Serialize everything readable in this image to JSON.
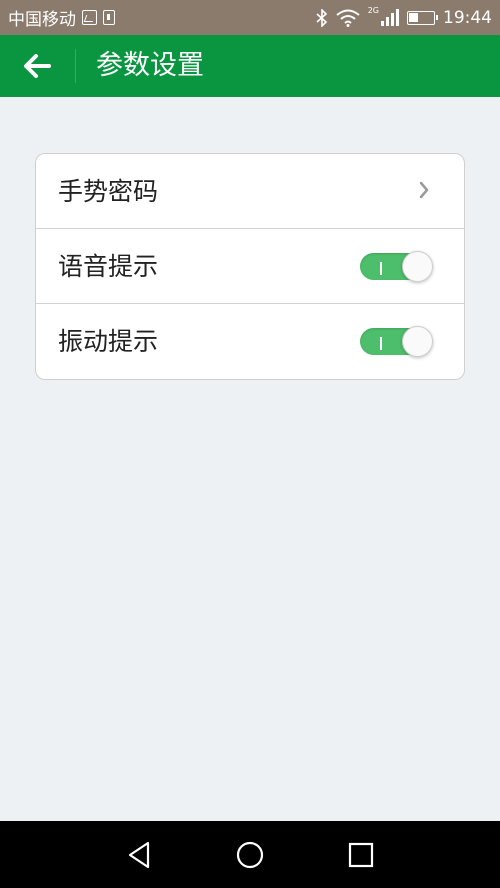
{
  "status_bar": {
    "carrier": "中国移动",
    "network_label": "2G",
    "time": "19:44",
    "icons": [
      "image-icon",
      "sd-card-icon",
      "bluetooth-icon",
      "wifi-icon",
      "signal-icon",
      "battery-icon"
    ]
  },
  "app_bar": {
    "title": "参数设置",
    "back_icon": "arrow-left-icon",
    "background_color": "#0a9640"
  },
  "settings": {
    "items": [
      {
        "label": "手势密码",
        "control": "chevron",
        "icon": "chevron-right-icon"
      },
      {
        "label": "语音提示",
        "control": "toggle",
        "on": true
      },
      {
        "label": "振动提示",
        "control": "toggle",
        "on": true
      }
    ],
    "toggle_on_color": "#4dbe6b"
  },
  "nav_bar": {
    "buttons": [
      "back-triangle-icon",
      "home-circle-icon",
      "recents-square-icon"
    ]
  }
}
